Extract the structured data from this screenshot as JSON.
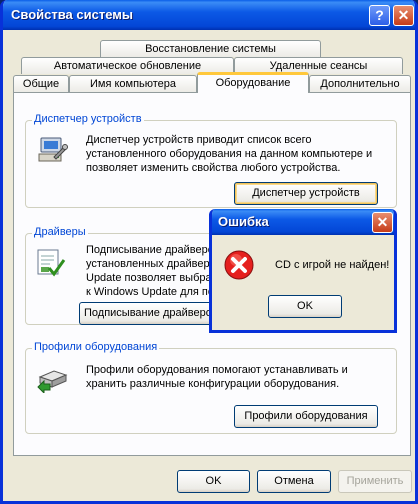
{
  "window": {
    "title": "Свойства системы",
    "help_glyph": "?",
    "close_glyph": "✕"
  },
  "tabs": {
    "row1": [
      "Восстановление системы"
    ],
    "row2": [
      "Автоматическое обновление",
      "Удаленные сеансы"
    ],
    "row3": [
      "Общие",
      "Имя компьютера",
      "Оборудование",
      "Дополнительно"
    ],
    "active": "Оборудование"
  },
  "device_manager": {
    "legend": "Диспетчер устройств",
    "text": [
      "Диспетчер устройств приводит список всего",
      "установленного оборудования на данном компьютере и",
      "позволяет изменить свойства любого устройства."
    ],
    "button": "Диспетчер устройств"
  },
  "drivers": {
    "legend": "Драйверы",
    "text": [
      "Подписывание драйверо",
      "установленных драйвер",
      "Update позволяет выбра",
      "к Windows Update для по"
    ],
    "button": "Подписывание драйверо"
  },
  "profiles": {
    "legend": "Профили оборудования",
    "text": [
      "Профили оборудования помогают устанавливать и",
      "хранить различные конфигурации оборудования."
    ],
    "button": "Профили оборудования"
  },
  "footer": {
    "ok": "OK",
    "cancel": "Отмена",
    "apply": "Применить"
  },
  "error_dialog": {
    "title": "Ошибка",
    "message": "CD с игрой не найден!",
    "ok": "OK",
    "close_glyph": "✕"
  },
  "colors": {
    "title_blue": "#0c59e6",
    "legend_blue": "#0046d5",
    "active_tab_accent": "#ffc83c",
    "error_red": "#e5201e"
  },
  "icons": [
    "device-manager-icon",
    "drivers-icon",
    "hardware-profiles-icon",
    "error-icon"
  ]
}
